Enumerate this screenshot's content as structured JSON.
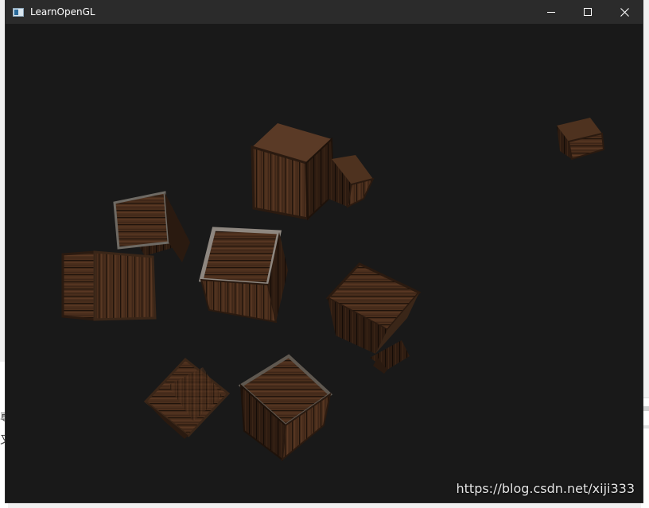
{
  "window": {
    "title": "LearnOpenGL",
    "controls": {
      "minimize": "minimize-icon",
      "maximize": "maximize-icon",
      "close": "close-icon"
    }
  },
  "scene": {
    "background_color": "#191919",
    "object": "wooden crate",
    "crate_count": 10
  },
  "watermark": "https://blog.csdn.net/xiji333",
  "background_app": {
    "left_glyphs": [
      "尃",
      "又"
    ]
  }
}
